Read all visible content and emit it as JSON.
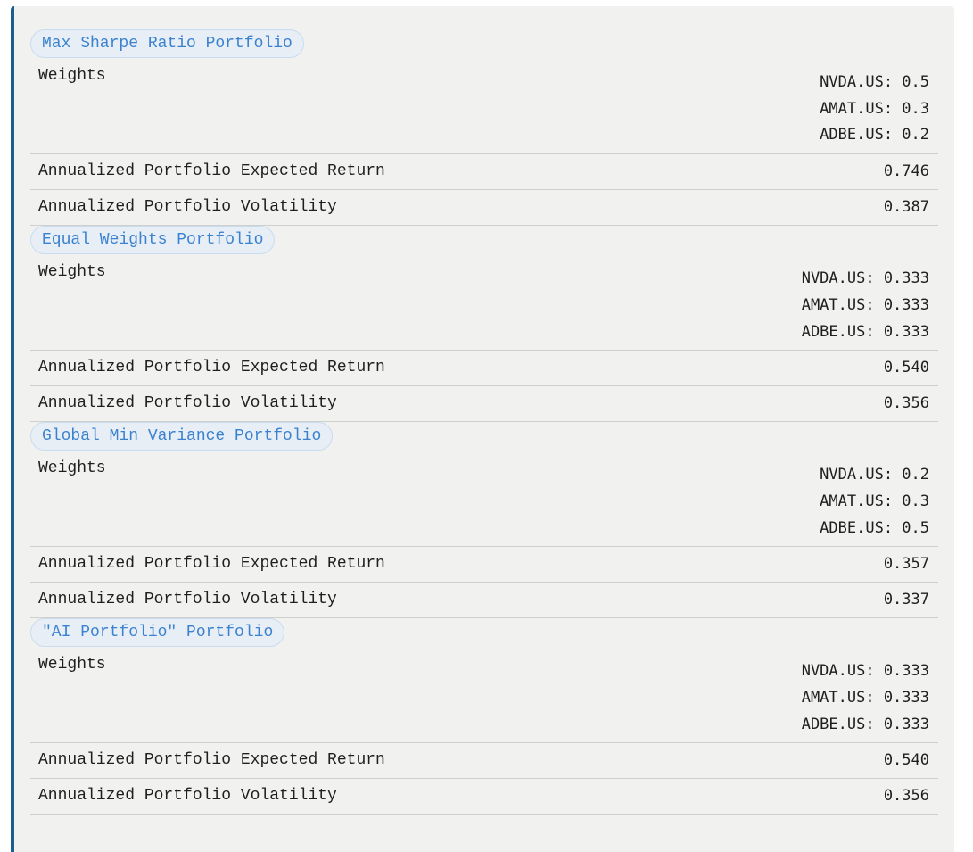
{
  "portfolios": [
    {
      "title": "Max Sharpe Ratio Portfolio",
      "weights_label": "Weights",
      "weights": [
        "NVDA.US: 0.5",
        "AMAT.US: 0.3",
        "ADBE.US: 0.2"
      ],
      "return_label": "Annualized Portfolio Expected Return",
      "return_value": "0.746",
      "volatility_label": "Annualized Portfolio Volatility",
      "volatility_value": "0.387"
    },
    {
      "title": "Equal Weights Portfolio",
      "weights_label": "Weights",
      "weights": [
        "NVDA.US: 0.333",
        "AMAT.US: 0.333",
        "ADBE.US: 0.333"
      ],
      "return_label": "Annualized Portfolio Expected Return",
      "return_value": "0.540",
      "volatility_label": "Annualized Portfolio Volatility",
      "volatility_value": "0.356"
    },
    {
      "title": "Global Min Variance Portfolio",
      "weights_label": "Weights",
      "weights": [
        "NVDA.US: 0.2",
        "AMAT.US: 0.3",
        "ADBE.US: 0.5"
      ],
      "return_label": "Annualized Portfolio Expected Return",
      "return_value": "0.357",
      "volatility_label": "Annualized Portfolio Volatility",
      "volatility_value": "0.337"
    },
    {
      "title": "\"AI Portfolio\" Portfolio",
      "weights_label": "Weights",
      "weights": [
        "NVDA.US: 0.333",
        "AMAT.US: 0.333",
        "ADBE.US: 0.333"
      ],
      "return_label": "Annualized Portfolio Expected Return",
      "return_value": "0.540",
      "volatility_label": "Annualized Portfolio Volatility",
      "volatility_value": "0.356"
    }
  ],
  "colors": {
    "accent_border": "#1c5f8f",
    "pill_text": "#3a82cf",
    "panel_bg": "#f1f1ef"
  }
}
